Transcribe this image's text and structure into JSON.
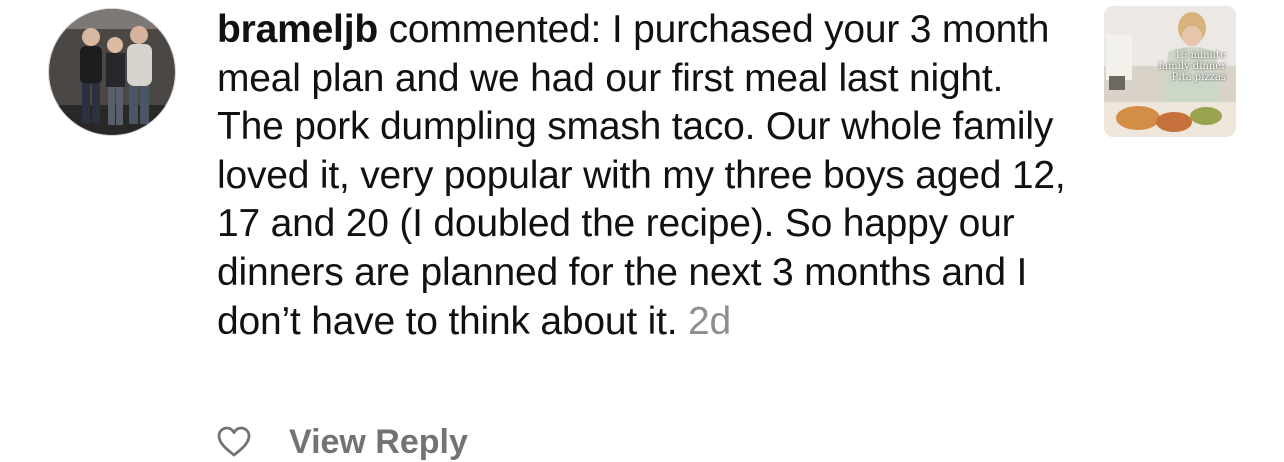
{
  "comment": {
    "username": "brameljb",
    "action": "commented:",
    "text": "I purchased your 3 month meal plan and we had our first meal last night. The pork dumpling smash taco. Our whole family loved it, very popular with my three boys aged 12, 17 and 20 (I doubled the recipe). So happy our dinners are planned for the next 3 months and I don’t have to think about it.",
    "timestamp": "2d"
  },
  "post_thumbnail": {
    "caption_line1": "15 minute",
    "caption_line2": "family dinner",
    "caption_line3": "Pita pizzas"
  },
  "actions": {
    "view_reply": "View Reply"
  },
  "icons": {
    "like": "heart-icon"
  },
  "colors": {
    "text": "#111111",
    "muted": "#8e8e8e",
    "action": "#737373"
  }
}
